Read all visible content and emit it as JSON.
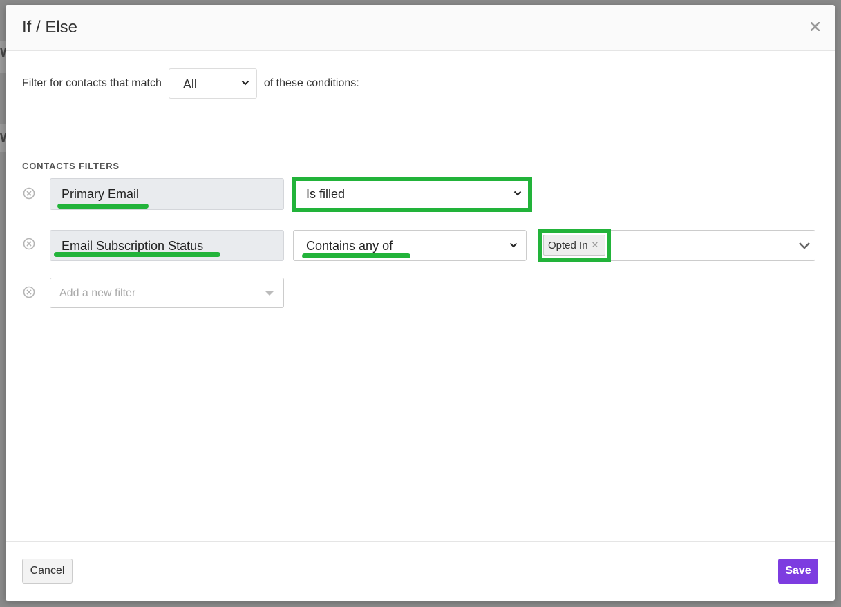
{
  "dialog": {
    "title": "If / Else"
  },
  "match": {
    "prefix": "Filter for contacts that match",
    "selected": "All",
    "suffix": "of these conditions:"
  },
  "filters_section": {
    "label": "CONTACTS FILTERS",
    "rows": [
      {
        "field": "Primary Email",
        "operator": "Is filled"
      },
      {
        "field": "Email Subscription Status",
        "operator": "Contains any of",
        "values": [
          "Opted In"
        ]
      }
    ],
    "add_placeholder": "Add a new filter"
  },
  "footer": {
    "cancel_label": "Cancel",
    "save_label": "Save"
  },
  "colors": {
    "highlight": "#22b33a",
    "save_button": "#7d3ce0",
    "field_background": "#e9ebee"
  },
  "icons": {
    "close": "close-icon",
    "remove": "remove-filter-icon",
    "chevron": "chevron-down-icon"
  }
}
